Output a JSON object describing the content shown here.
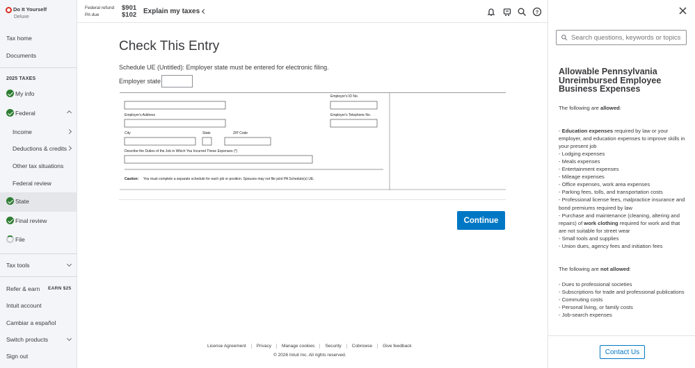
{
  "brand": {
    "logo": "Do It Yourself",
    "edition": "Deluxe"
  },
  "sidebar": {
    "tax_home": "Tax home",
    "documents": "Documents",
    "section_title": "2025 TAXES",
    "my_info": "My info",
    "federal": "Federal",
    "income": "Income",
    "deductions": "Deductions & credits",
    "other": "Other tax situations",
    "federal_review": "Federal review",
    "state": "State",
    "final_review": "Final review",
    "file": "File",
    "tax_tools": "Tax tools",
    "refer": "Refer & earn",
    "earn_badge": "EARN $25",
    "intuit_account": "Intuit account",
    "espanol": "Cambiar a español",
    "switch_products": "Switch products",
    "sign_out": "Sign out"
  },
  "topbar": {
    "federal_label": "Federal refund",
    "federal_amount": "$901",
    "pa_label": "PA due",
    "pa_amount": "$102",
    "explain": "Explain my taxes"
  },
  "main": {
    "title": "Check This Entry",
    "instruction": "Schedule UE (Untitled): Employer state must be entered for electronic filing.",
    "employer_state_label": "Employer state",
    "employer_state_value": "",
    "form": {
      "employer_id": "Employer's ID No.",
      "employer_address": "Employer's Address",
      "employer_phone": "Employer's Telephone No.",
      "city": "City",
      "state": "State",
      "zip": "ZIP Code",
      "describe": "Describe the Duties of the Job in Which You Incurred These Expenses (*)",
      "caution_prefix": "Caution:",
      "caution_text": "You must complete a separate schedule for each job or position. Spouses may not file joint PA Schedule(s) UE."
    },
    "continue": "Continue"
  },
  "footer": {
    "links": [
      "License Agreement",
      "Privacy",
      "Manage cookies",
      "Security",
      "Cobrowse",
      "Give feedback"
    ],
    "copyright": "© 2026 Intuit Inc. All rights reserved."
  },
  "panel": {
    "search_placeholder": "Search questions, keywords or topics",
    "title": "Allowable Pennsylvania Unreimbursed Employee Business Expenses",
    "allowed_intro": "The following are",
    "allowed_word": "allowed",
    "not_allowed_intro": "The following are",
    "not_allowed_word": "not allowed",
    "contact": "Contact Us"
  },
  "colors": {
    "accent": "#0077c5",
    "check": "#2e7d32",
    "logo_red": "#d52b1e"
  }
}
